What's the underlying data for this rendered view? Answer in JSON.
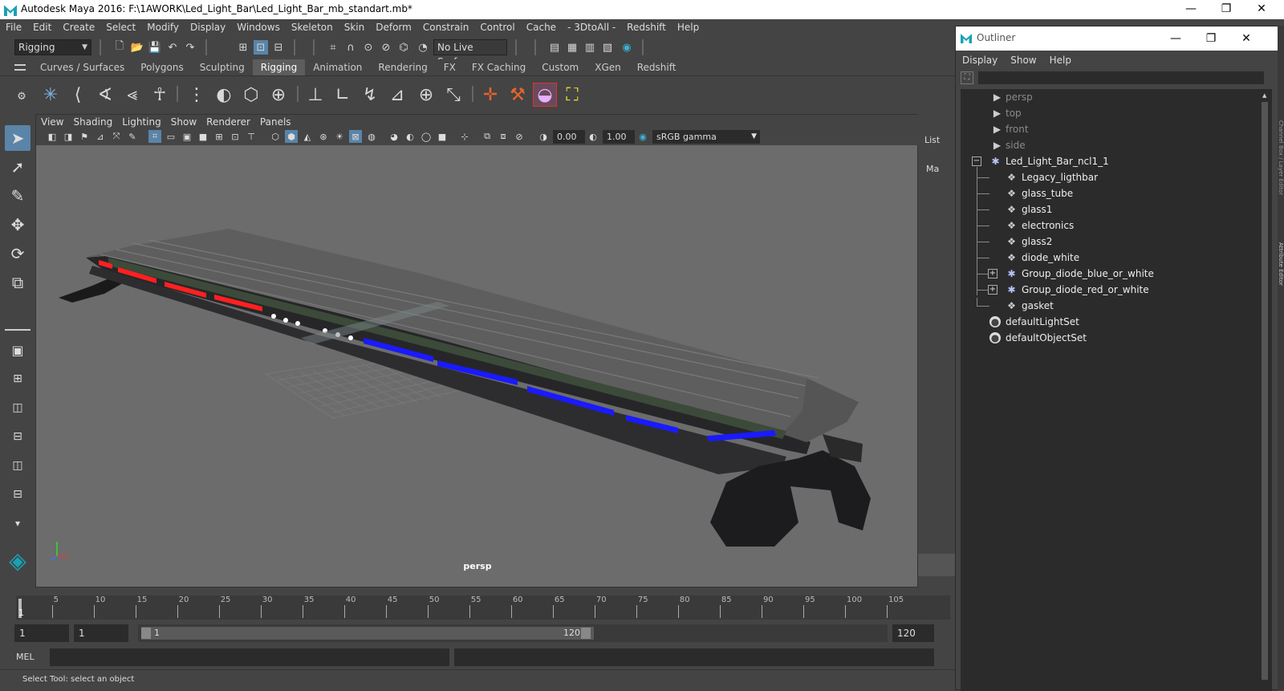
{
  "window": {
    "title": "Autodesk Maya 2016: F:\\1AWORK\\Led_Light_Bar\\Led_Light_Bar_mb_standart.mb*",
    "minimize": "—",
    "restore": "❐",
    "close": "✕"
  },
  "menubar": [
    "File",
    "Edit",
    "Create",
    "Select",
    "Modify",
    "Display",
    "Windows",
    "Skeleton",
    "Skin",
    "Deform",
    "Constrain",
    "Control",
    "Cache",
    "- 3DtoAll -",
    "Redshift",
    "Help"
  ],
  "statusline": {
    "mode": "Rigging",
    "live_surface": "No Live Surface"
  },
  "shelf_tabs": [
    "Curves / Surfaces",
    "Polygons",
    "Sculpting",
    "Rigging",
    "Animation",
    "Rendering",
    "FX",
    "FX Caching",
    "Custom",
    "XGen",
    "Redshift"
  ],
  "active_shelf": "Rigging",
  "viewport": {
    "menu": [
      "View",
      "Shading",
      "Lighting",
      "Show",
      "Renderer",
      "Panels"
    ],
    "exposure": "0.00",
    "gamma": "1.00",
    "color_space": "sRGB gamma",
    "camera_label": "persp"
  },
  "right_strip": {
    "list": "List",
    "ma": "Ma"
  },
  "timeline": {
    "ticks": [
      "5",
      "10",
      "15",
      "20",
      "25",
      "30",
      "35",
      "40",
      "45",
      "50",
      "55",
      "60",
      "65",
      "70",
      "75",
      "80",
      "85",
      "90",
      "95",
      "100",
      "105"
    ],
    "current_frame": "1"
  },
  "range": {
    "start": "1",
    "playback_start": "1",
    "slider_start": "1",
    "slider_end": "120",
    "end": "120"
  },
  "command": {
    "label": "MEL"
  },
  "helpline": "Select Tool: select an object",
  "outliner": {
    "title": "Outliner",
    "menu": [
      "Display",
      "Show",
      "Help"
    ],
    "cameras": [
      "persp",
      "top",
      "front",
      "side"
    ],
    "root": "Led_Light_Bar_ncl1_1",
    "children": [
      "Legacy_ligthbar",
      "glass_tube",
      "glass1",
      "electronics",
      "glass2",
      "diode_white",
      "Group_diode_blue_or_white",
      "Group_diode_red_or_white",
      "gasket"
    ],
    "sets": [
      "defaultLightSet",
      "defaultObjectSet"
    ],
    "side_tabs": [
      "Channel Box / Layer Editor",
      "Attribute Editor"
    ]
  },
  "colors": {
    "accent": "#5a84a8",
    "maya_teal": "#1ba1b3",
    "red_led": "#ff2020",
    "blue_led": "#1a1aff"
  }
}
